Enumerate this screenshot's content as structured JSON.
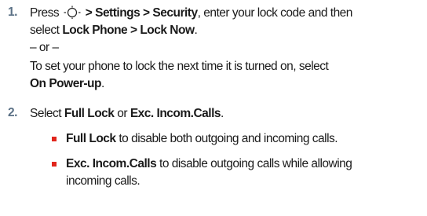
{
  "steps": [
    {
      "number": "1.",
      "line1_pre": "Press ",
      "nav_key_icon": "navigation-key-icon",
      "line1_path": " > Settings > Security",
      "line1_post": ", enter your lock code and then",
      "line2_pre": "select ",
      "line2_bold": "Lock Phone > Lock Now",
      "line2_post": ".",
      "or_text": "– or –",
      "line4": "To set your phone to lock the next time it is turned on, select",
      "line5_bold": "On Power-up",
      "line5_post": "."
    },
    {
      "number": "2.",
      "pre": "Select ",
      "bold1": "Full Lock",
      "mid": " or ",
      "bold2": "Exc. Incom.Calls",
      "post": ".",
      "bullets": [
        {
          "bold": "Full Lock",
          "text": " to disable both outgoing and incoming calls.",
          "cont": ""
        },
        {
          "bold": "Exc. Incom.Calls",
          "text": " to disable outgoing calls while allowing",
          "cont": "incoming calls."
        }
      ]
    }
  ],
  "colors": {
    "number": "#5b7186",
    "bullet": "#e1261c",
    "text": "#1a1a1a"
  }
}
